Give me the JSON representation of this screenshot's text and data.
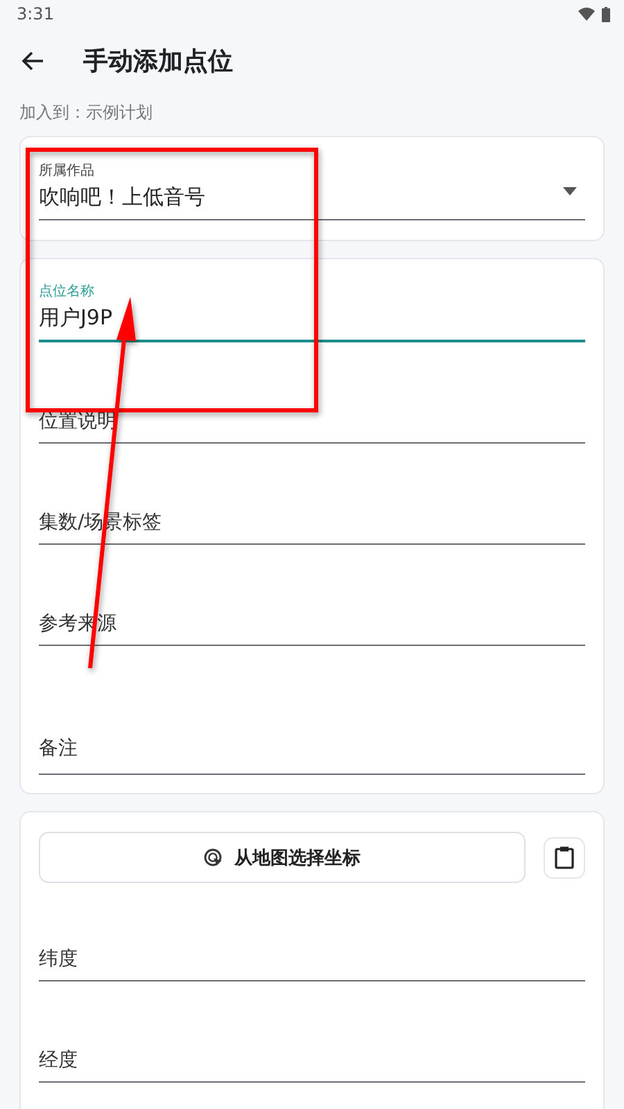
{
  "status_bar": {
    "time": "3:31"
  },
  "app_bar": {
    "title": "手动添加点位"
  },
  "target": "加入到：示例计划",
  "work_field": {
    "label": "所属作品",
    "value": "吹响吧！上低音号"
  },
  "fields": [
    {
      "label": "点位名称",
      "value": "用户J9P",
      "focused": true
    },
    {
      "label": "位置说明",
      "focused": false
    },
    {
      "label": "集数/场景标签",
      "focused": false
    },
    {
      "label": "参考来源",
      "focused": false
    },
    {
      "label": "备注",
      "focused": false
    }
  ],
  "map_button": {
    "label": "从地图选择坐标"
  },
  "coordinate_fields": [
    {
      "label": "纬度"
    },
    {
      "label": "经度"
    }
  ]
}
